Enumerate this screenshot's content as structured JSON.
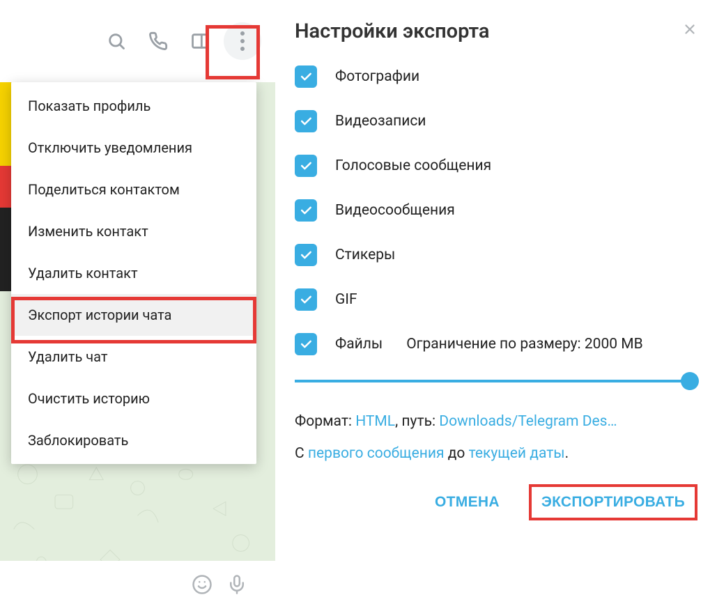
{
  "left": {
    "menu_items": [
      "Показать профиль",
      "Отключить уведомления",
      "Поделиться контактом",
      "Изменить контакт",
      "Удалить контакт",
      "Экспорт истории чата",
      "Удалить чат",
      "Очистить историю",
      "Заблокировать"
    ],
    "highlighted_index": 5,
    "icons": {
      "search": "search-icon",
      "call": "call-icon",
      "panel": "side-panel-icon",
      "more": "more-vertical-icon",
      "emoji": "emoji-icon",
      "mic": "microphone-icon"
    }
  },
  "dialog": {
    "title": "Настройки экспорта",
    "options": [
      "Фотографии",
      "Видеозаписи",
      "Голосовые сообщения",
      "Видеосообщения",
      "Стикеры",
      "GIF",
      "Файлы"
    ],
    "size_limit": "Ограничение по размеру: 2000 MB",
    "line1_format_label": "Формат: ",
    "line1_format_value": "HTML",
    "line1_path_label": ", путь: ",
    "line1_path_value": "Downloads/Telegram Des…",
    "line2_prefix": "С ",
    "line2_from": "первого сообщения",
    "line2_mid": " до ",
    "line2_to": "текущей даты",
    "line2_suffix": ".",
    "cancel": "ОТМЕНА",
    "export": "ЭКСПОРТИРОВАТЬ"
  },
  "colors": {
    "accent": "#39ade2",
    "highlight": "#e53935"
  }
}
